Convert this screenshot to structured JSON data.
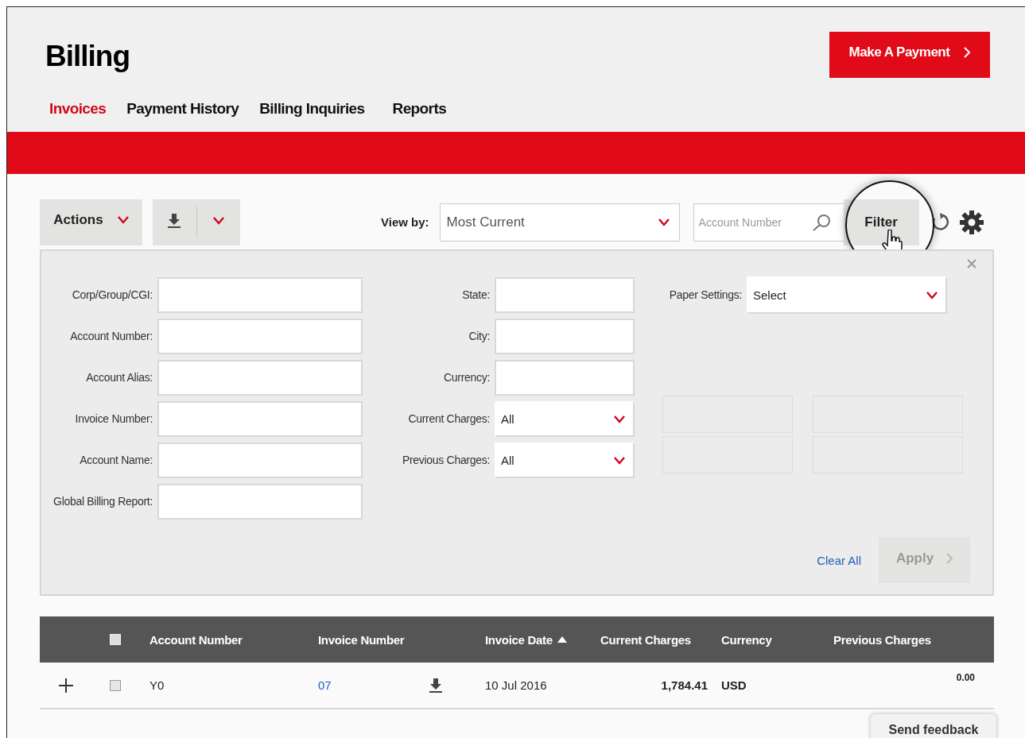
{
  "header": {
    "title": "Billing",
    "pay_button": "Make A Payment"
  },
  "tabs": [
    {
      "label": "Invoices",
      "selected": true
    },
    {
      "label": "Payment History",
      "selected": false
    },
    {
      "label": "Billing Inquiries",
      "selected": false
    },
    {
      "label": "Reports",
      "selected": false
    }
  ],
  "toolbar": {
    "actions": "Actions",
    "view_by_label": "View by:",
    "view_by_value": "Most Current",
    "search": {
      "placeholder": "Account Number"
    },
    "filter_button": "Filter"
  },
  "filter": {
    "columns": [
      [
        {
          "kind": "text",
          "label": "Corp/Group/CGI:"
        },
        {
          "kind": "text",
          "label": "Account Number:"
        },
        {
          "kind": "text",
          "label": "Account Alias:"
        },
        {
          "kind": "text",
          "label": "Invoice Number:"
        },
        {
          "kind": "text",
          "label": "Account Name:"
        },
        {
          "kind": "text",
          "label": "Global Billing Report:"
        }
      ],
      [
        {
          "kind": "text",
          "label": "State:"
        },
        {
          "kind": "text",
          "label": "City:"
        },
        {
          "kind": "text",
          "label": "Currency:"
        },
        {
          "kind": "select",
          "label": "Current Charges:",
          "value": "All"
        },
        {
          "kind": "select",
          "label": "Previous Charges:",
          "value": "All"
        }
      ],
      [
        {
          "kind": "select",
          "label": "Paper Settings:",
          "value": "Select"
        }
      ]
    ],
    "clear": "Clear All",
    "apply": {
      "label": "Apply",
      "disabled": true
    }
  },
  "table": {
    "select_all_checked": false,
    "columns": [
      {
        "label": "Account Number",
        "sorted": false
      },
      {
        "label": "Invoice Number",
        "sorted": false
      },
      {
        "label": "Invoice Date",
        "sorted": true
      },
      {
        "label": "Current Charges",
        "sorted": false
      },
      {
        "label": "Currency",
        "sorted": false
      },
      {
        "label": "Previous Charges",
        "sorted": false
      }
    ],
    "rows": [
      {
        "checked": false,
        "account": "Y0",
        "invoice": "07",
        "date": "10 Jul 2016",
        "current": "1,784.41",
        "currency": "USD",
        "previous": "0.00"
      }
    ]
  },
  "feedback": "Send feedback"
}
